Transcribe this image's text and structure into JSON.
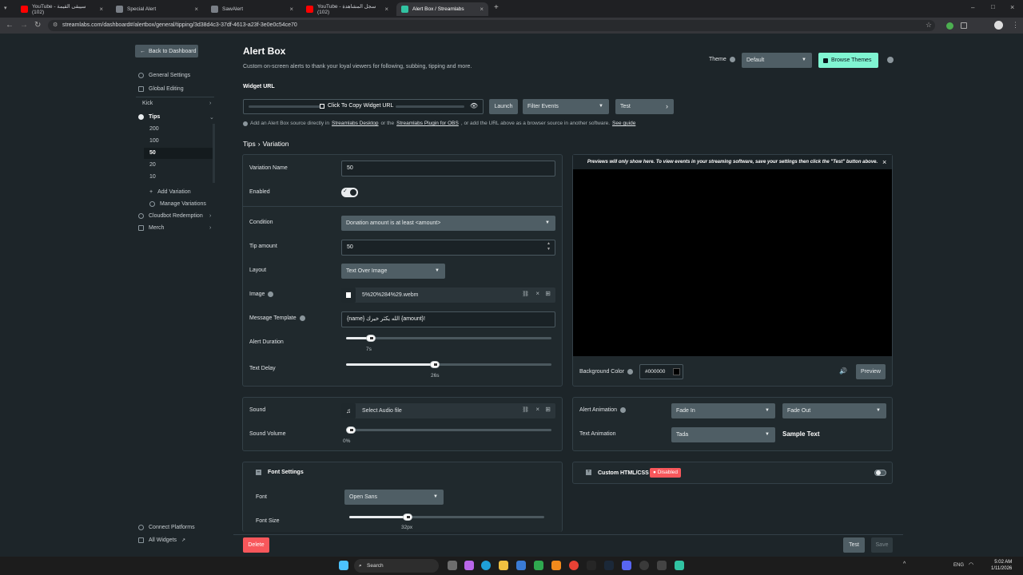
{
  "browser": {
    "tabs": [
      {
        "title": "YouTube - سيبقى القيمة (102)",
        "active": false,
        "favicon_color": "#ff0000"
      },
      {
        "title": "Special Alert",
        "active": false,
        "favicon_color": "#7a7f87"
      },
      {
        "title": "SawAlert",
        "active": false,
        "favicon_color": "#7a7f87"
      },
      {
        "title": "YouTube - سجل المشاهدة (102)",
        "active": false,
        "favicon_color": "#ff0000"
      },
      {
        "title": "Alert Box / Streamlabs",
        "active": true,
        "favicon_color": "#31c3a2"
      }
    ],
    "url": "streamlabs.com/dashboard#/alertbox/general/tipping/3d38d4c3-37df-4613-a23f-3e0e0c54ce70"
  },
  "sidebar": {
    "back_label": "Back to Dashboard",
    "items": [
      {
        "label": "General Settings",
        "icon": "gear-icon"
      },
      {
        "label": "Global Editing",
        "icon": "edit-icon"
      },
      {
        "label": "Kick",
        "icon": ""
      },
      {
        "label": "Tips",
        "icon": "tips-icon"
      },
      {
        "label": "Cloudbot Redemption",
        "icon": "cloudbot-icon"
      },
      {
        "label": "Merch",
        "icon": "merch-icon"
      }
    ],
    "tip_variations": [
      "200",
      "100",
      "50",
      "20",
      "10"
    ],
    "selected_variation": "50",
    "add_variation": "Add Variation",
    "manage_variations": "Manage Variations",
    "connect_platforms": "Connect Platforms",
    "all_widgets": "All Widgets"
  },
  "header": {
    "title": "Alert Box",
    "subtitle": "Custom on-screen alerts to thank your loyal viewers for following, subbing, tipping and more.",
    "theme_label": "Theme",
    "theme_value": "Default",
    "browse_themes": "Browse Themes"
  },
  "widget": {
    "url_label": "Widget URL",
    "copy_label": "Click To Copy Widget URL",
    "launch": "Launch",
    "filter_events": "Filter Events",
    "test": "Test",
    "info_prefix": "Add an Alert Box source directly in",
    "link1": "Streamlabs Desktop",
    "info_mid": "or the",
    "link2": "Streamlabs Plugin for OBS",
    "info_suffix": ", or add the URL above as a browser source in another software.",
    "link3": "See guide"
  },
  "breadcrumb": {
    "parent": "Tips",
    "sep": "›",
    "current": "Variation"
  },
  "form": {
    "variation_name_label": "Variation Name",
    "variation_name": "50",
    "enabled_label": "Enabled",
    "enabled": true,
    "condition_label": "Condition",
    "condition": "Donation amount is at least <amount>",
    "tip_amount_label": "Tip amount",
    "tip_amount": "50",
    "layout_label": "Layout",
    "layout": "Text Over Image",
    "image_label": "Image",
    "image_file": "5%20%284%29.webm",
    "message_label": "Message Template",
    "message": "{name} الله يكثر خيرك {amount}!",
    "duration_label": "Alert Duration",
    "duration": "7s",
    "duration_fraction": 0.12,
    "delay_label": "Text Delay",
    "delay": "26s",
    "delay_fraction": 0.43,
    "sound_label": "Sound",
    "sound_file": "Select Audio file",
    "volume_label": "Sound Volume",
    "volume": "0%",
    "volume_fraction": 0.0,
    "font_settings": "Font Settings",
    "font_label": "Font",
    "font": "Open Sans",
    "font_size_label": "Font Size",
    "font_size": "32px",
    "font_size_fraction": 0.3
  },
  "preview": {
    "notice": "Previews will only show here. To view events in your streaming software, save your settings then click the \"Test\" button above.",
    "bg_label": "Background Color",
    "bg_value": "#000000",
    "preview_btn": "Preview"
  },
  "animation": {
    "alert_label": "Alert Animation",
    "in": "Fade In",
    "out": "Fade Out",
    "text_label": "Text Animation",
    "text": "Tada",
    "sample": "Sample Text"
  },
  "custom": {
    "label": "Custom HTML/CSS",
    "badge": "Disabled",
    "enabled": false
  },
  "footer": {
    "delete": "Delete",
    "test": "Test",
    "save": "Save"
  },
  "taskbar": {
    "search": "Search",
    "lang": "ENG",
    "time": "5:02 AM",
    "date": "1/11/2026"
  },
  "colors": {
    "accent": "#80f5d2",
    "danger": "#f8575b",
    "panel": "#20292d"
  }
}
